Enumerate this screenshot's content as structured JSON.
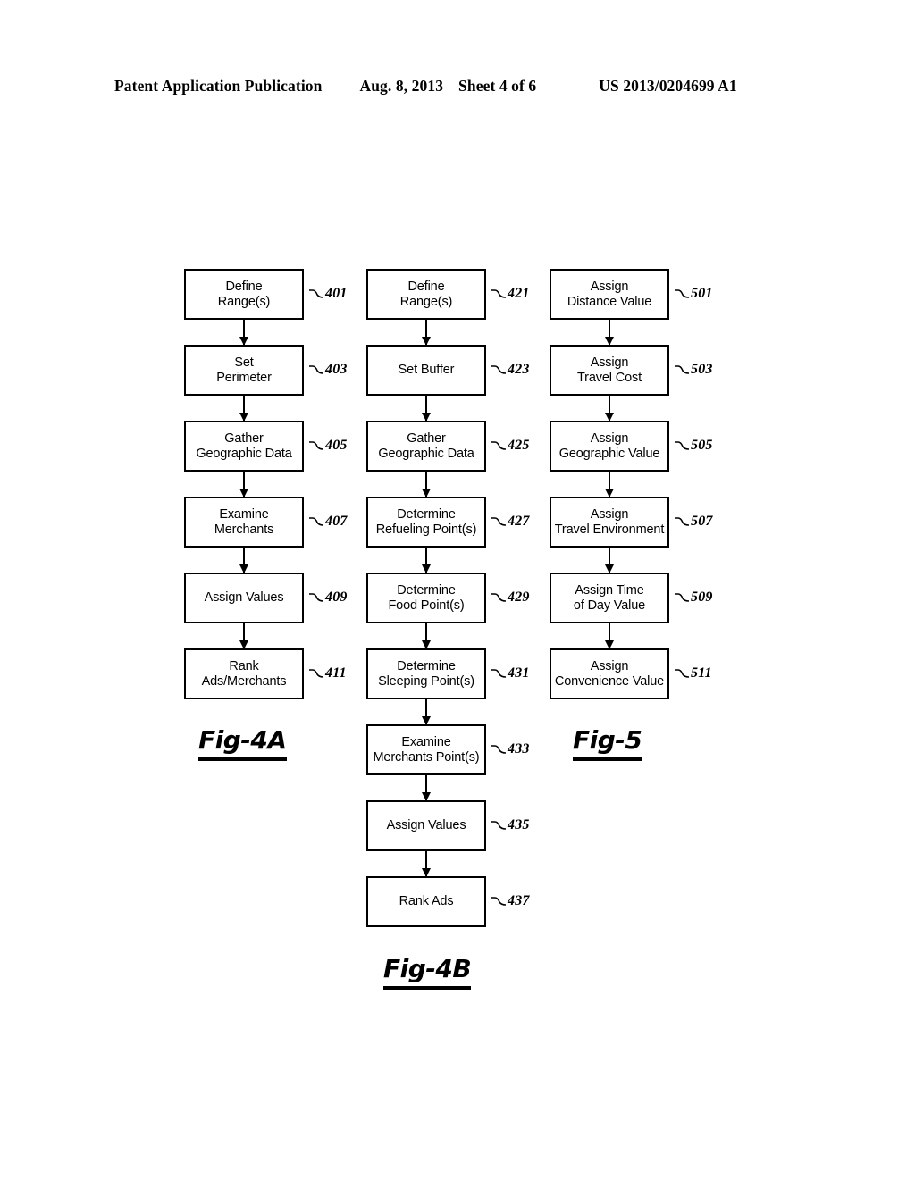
{
  "header": {
    "publication": "Patent Application Publication",
    "date": "Aug. 8, 2013",
    "sheet": "Sheet 4 of 6",
    "patent_number": "US 2013/0204699 A1"
  },
  "figures": [
    {
      "id": "fig-4a",
      "caption": "Fig-4A",
      "nodes": [
        {
          "label": "Define\nRange(s)",
          "ref": "401"
        },
        {
          "label": "Set\nPerimeter",
          "ref": "403"
        },
        {
          "label": "Gather\nGeographic Data",
          "ref": "405"
        },
        {
          "label": "Examine\nMerchants",
          "ref": "407"
        },
        {
          "label": "Assign Values",
          "ref": "409"
        },
        {
          "label": "Rank\nAds/Merchants",
          "ref": "411"
        }
      ]
    },
    {
      "id": "fig-4b",
      "caption": "Fig-4B",
      "nodes": [
        {
          "label": "Define\nRange(s)",
          "ref": "421"
        },
        {
          "label": "Set Buffer",
          "ref": "423"
        },
        {
          "label": "Gather\nGeographic Data",
          "ref": "425"
        },
        {
          "label": "Determine\nRefueling Point(s)",
          "ref": "427"
        },
        {
          "label": "Determine\nFood Point(s)",
          "ref": "429"
        },
        {
          "label": "Determine\nSleeping Point(s)",
          "ref": "431"
        },
        {
          "label": "Examine\nMerchants Point(s)",
          "ref": "433"
        },
        {
          "label": "Assign Values",
          "ref": "435"
        },
        {
          "label": "Rank Ads",
          "ref": "437"
        }
      ]
    },
    {
      "id": "fig-5",
      "caption": "Fig-5",
      "nodes": [
        {
          "label": "Assign\nDistance Value",
          "ref": "501"
        },
        {
          "label": "Assign\nTravel Cost",
          "ref": "503"
        },
        {
          "label": "Assign\nGeographic Value",
          "ref": "505"
        },
        {
          "label": "Assign\nTravel Environment",
          "ref": "507"
        },
        {
          "label": "Assign Time\nof Day Value",
          "ref": "509"
        },
        {
          "label": "Assign\nConvenience Value",
          "ref": "511"
        }
      ]
    }
  ]
}
